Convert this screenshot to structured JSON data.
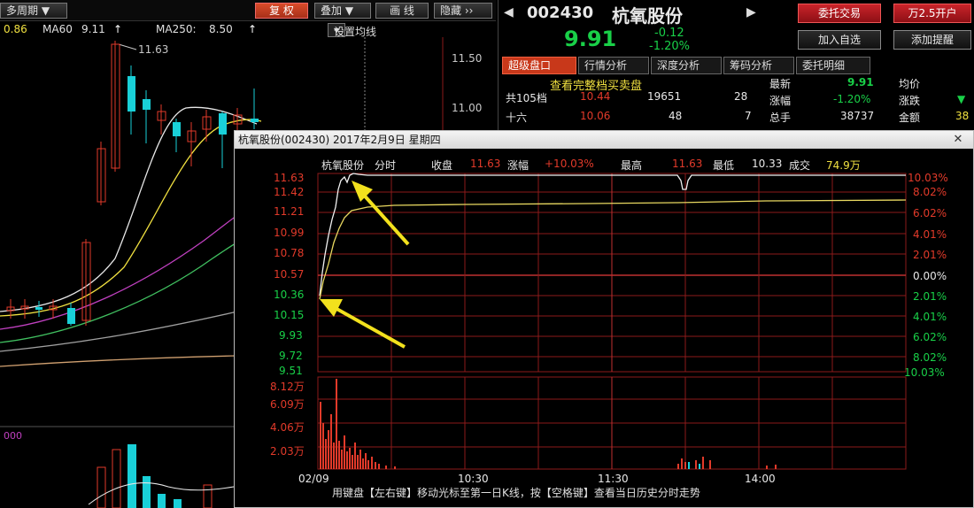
{
  "toolbar": {
    "period": "多周期",
    "rights": "复 权",
    "overlay": "叠加",
    "drawline": "画 线",
    "hide": "隐藏"
  },
  "ma": {
    "ma_prev_value": "0.86",
    "ma60_label": "MA60",
    "ma60_value": "9.11",
    "ma250_label": "MA250:",
    "ma250_value": "8.50",
    "settings": "设置均线"
  },
  "kline": {
    "high_label": "11.63",
    "price_axis": [
      "11.50",
      "11.00"
    ],
    "subchart_label": "000"
  },
  "quote": {
    "code": "002430",
    "name": "杭氧股份",
    "price": "9.91",
    "change": "-0.12",
    "change_pct": "-1.20%",
    "btn_entrust": "委托交易",
    "btn_open": "万2.5开户",
    "btn_watch": "加入自选",
    "btn_alert": "添加提醒",
    "tabs": [
      "超级盘口",
      "行情分析",
      "深度分析",
      "筹码分析",
      "委托明细"
    ],
    "full_queue": "查看完整档买卖盘",
    "rows": [
      {
        "label": "共105档",
        "price": "10.44",
        "vol": "19651",
        "num": "28"
      },
      {
        "label": "十六",
        "price": "10.06",
        "vol": "48",
        "num": "7"
      }
    ],
    "stats": [
      {
        "k": "最新",
        "v": "9.91",
        "k2": "均价"
      },
      {
        "k": "涨幅",
        "v": "-1.20%",
        "k2": "涨跌"
      },
      {
        "k": "总手",
        "v": "38737",
        "k2": "金额",
        "v2": "38"
      }
    ]
  },
  "popup": {
    "title": "杭氧股份(002430) 2017年2月9日 星期四",
    "info": {
      "name": "杭氧股份",
      "type": "分时",
      "close_label": "收盘",
      "close": "11.63",
      "chg_label": "涨幅",
      "chg": "+10.03%",
      "high_label": "最高",
      "high": "11.63",
      "low_label": "最低",
      "low": "10.33",
      "vol_label": "成交",
      "vol": "74.9万"
    },
    "price_labels": [
      "11.63",
      "11.42",
      "11.21",
      "10.99",
      "10.78",
      "10.57",
      "10.36",
      "10.15",
      "9.93",
      "9.72",
      "9.51"
    ],
    "pct_labels": [
      "10.03%",
      "8.02%",
      "6.02%",
      "4.01%",
      "2.01%",
      "0.00%",
      "2.01%",
      "4.01%",
      "6.02%",
      "8.02%",
      "10.03%"
    ],
    "vol_labels": [
      "8.12万",
      "6.09万",
      "4.06万",
      "2.03万"
    ],
    "time_labels": [
      "02/09",
      "10:30",
      "11:30",
      "14:00"
    ],
    "footer": "用键盘【左右键】移动光标至第一日K线，按【空格键】查看当日历史分时走势"
  },
  "colors": {
    "up": "#e23a2a",
    "down": "#19d0d8",
    "arrow": "#f2e11d",
    "grid": "#8c1a1a"
  }
}
